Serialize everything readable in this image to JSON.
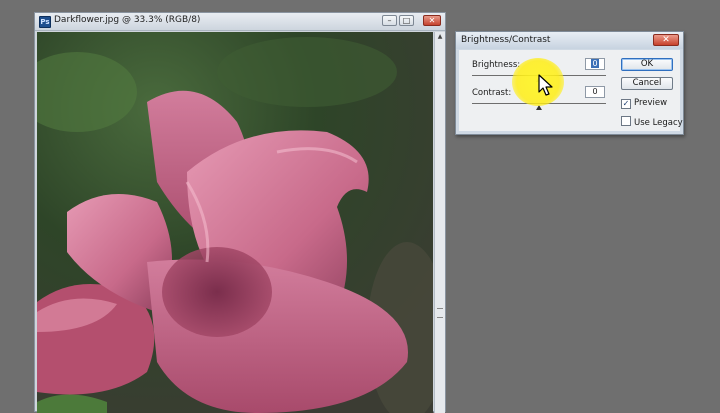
{
  "document": {
    "title": "Darkflower.jpg @ 33.3% (RGB/8)",
    "app_icon": "ps-icon",
    "controls": {
      "minimize": "minimize-icon",
      "maximize": "maximize-icon",
      "close": "close-icon"
    }
  },
  "dialog": {
    "title": "Brightness/Contrast",
    "close_icon": "close-icon",
    "brightness": {
      "label": "Brightness:",
      "value": "0"
    },
    "contrast": {
      "label": "Contrast:",
      "value": "0"
    },
    "ok_label": "OK",
    "cancel_label": "Cancel",
    "preview": {
      "label": "Preview",
      "checked": true
    },
    "use_legacy": {
      "label": "Use Legacy",
      "checked": false
    }
  },
  "colors": {
    "workspace": "#6f6f6f",
    "dialog_frame": "#cfd9e4",
    "cursor_highlight": "#fff028",
    "petal_pink": "#c86a8a"
  }
}
